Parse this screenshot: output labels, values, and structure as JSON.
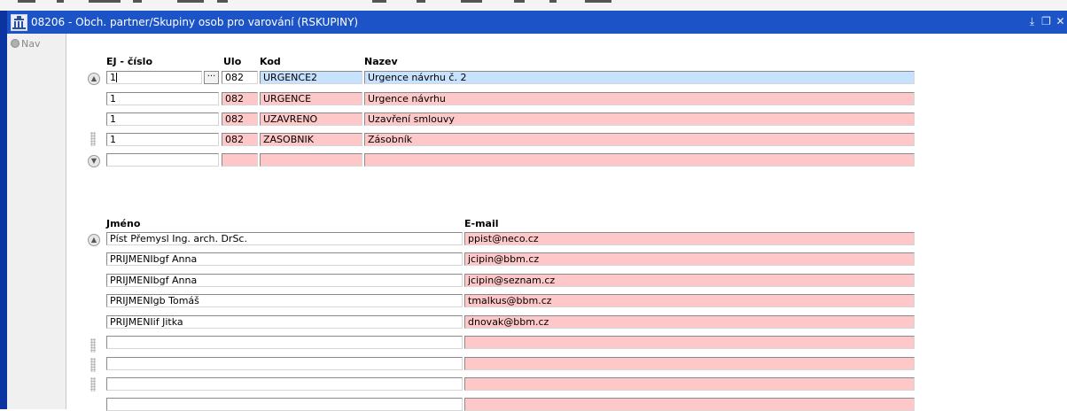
{
  "window": {
    "title": "08206 - Obch. partner/Skupiny osob pro varování (RSKUPINY)",
    "controls": [
      "minimize-icon",
      "restore-icon",
      "close-icon"
    ]
  },
  "nav": {
    "label": "Nav"
  },
  "groups_block": {
    "headers": {
      "ej": "EJ - číslo",
      "ulo": "Ulo",
      "kod": "Kod",
      "nazev": "Nazev"
    },
    "rows": [
      {
        "ej": "1",
        "ulo": "082",
        "kod": "URGENCE2",
        "nazev": "Urgence návrhu č. 2"
      },
      {
        "ej": "1",
        "ulo": "082",
        "kod": "URGENCE",
        "nazev": "Urgence návrhu"
      },
      {
        "ej": "1",
        "ulo": "082",
        "kod": "UZAVRENO",
        "nazev": "Uzavření smlouvy"
      },
      {
        "ej": "1",
        "ulo": "082",
        "kod": "ZASOBNIK",
        "nazev": "Zásobník"
      },
      {
        "ej": "",
        "ulo": "",
        "kod": "",
        "nazev": ""
      }
    ],
    "lov_button_label": "···"
  },
  "persons_block": {
    "headers": {
      "jmeno": "Jméno",
      "email": "E-mail"
    },
    "rows": [
      {
        "jmeno": "Píst Přemysl Ing. arch. DrSc.",
        "email": "ppist@neco.cz"
      },
      {
        "jmeno": "PRIJMENIbgf Anna",
        "email": "jcipin@bbm.cz"
      },
      {
        "jmeno": "PRIJMENIbgf Anna",
        "email": "jcipin@seznam.cz"
      },
      {
        "jmeno": "PRIJMENIgb Tomáš",
        "email": "tmalkus@bbm.cz"
      },
      {
        "jmeno": "PRIJMENIif Jitka",
        "email": "dnovak@bbm.cz"
      },
      {
        "jmeno": "",
        "email": ""
      },
      {
        "jmeno": "",
        "email": ""
      },
      {
        "jmeno": "",
        "email": ""
      },
      {
        "jmeno": "",
        "email": ""
      }
    ]
  },
  "colors": {
    "title_bar": "#1c54c8",
    "current_record": "#c6e2ff",
    "required_field": "#ffc8c8"
  }
}
